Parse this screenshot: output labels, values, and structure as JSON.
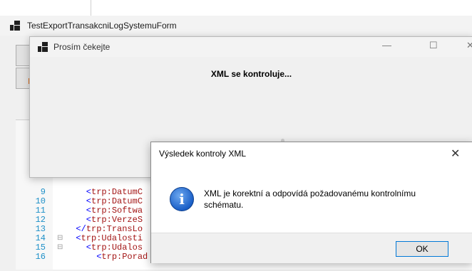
{
  "main_form": {
    "title": "TestExportTransakcniLogSystemuForm"
  },
  "wait_dialog": {
    "title": "Prosím čekejte",
    "message": "XML se kontroluje...",
    "controls": {
      "minimize": "—",
      "maximize": "☐",
      "close": "✕"
    }
  },
  "message_box": {
    "title": "Výsledek kontroly XML",
    "text": "XML je korektní a odpovídá požadovanému kontrolnímu schématu.",
    "ok_label": "OK",
    "close": "✕",
    "icon": "info-icon"
  },
  "editor": {
    "lines": [
      {
        "num": "9",
        "fold": "",
        "text": "    <trp:DatumC"
      },
      {
        "num": "10",
        "fold": "",
        "text": "    <trp:DatumC"
      },
      {
        "num": "11",
        "fold": "",
        "text": "    <trp:Softwa"
      },
      {
        "num": "12",
        "fold": "",
        "text": "    <trp:VerzeS"
      },
      {
        "num": "13",
        "fold": "",
        "text": "  </trp:TransLo"
      },
      {
        "num": "14",
        "fold": "⊟",
        "text": "  <trp:Udalosti"
      },
      {
        "num": "15",
        "fold": "⊟",
        "text": "    <trp:Udalos"
      },
      {
        "num": "16",
        "fold": "",
        "text": "      <trp:Porad"
      }
    ]
  }
}
